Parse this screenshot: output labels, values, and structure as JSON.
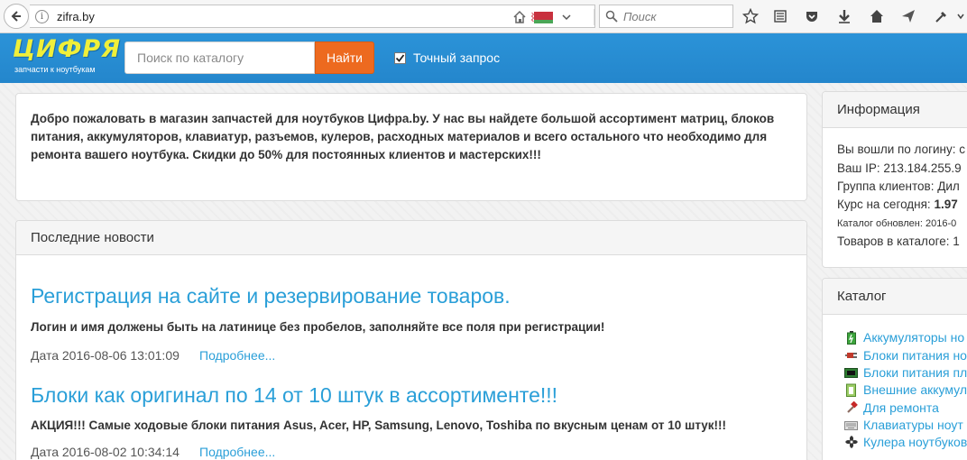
{
  "browser": {
    "url": "zifra.by",
    "search_placeholder": "Поиск"
  },
  "header": {
    "logo_text": "ЦИФРЯ",
    "logo_subtitle": "запчасти к ноутбукам",
    "search_placeholder": "Поиск по каталогу",
    "find_button": "Найти",
    "exact_label": "Точный запрос",
    "exact_checked": true
  },
  "welcome": {
    "text": "Добро пожаловать в магазин запчастей для ноутбуков Цифра.by. У нас вы найдете большой ассортимент матриц, блоков питания, аккумуляторов, клавиатур, разъемов, кулеров, расходных материалов и всего остального что необходимо для ремонта вашего ноутбука. Скидки до 50% для постоянных клиентов и мастерских!!!"
  },
  "news": {
    "heading": "Последние новости",
    "items": [
      {
        "title": "Регистрация на сайте и резервирование товаров.",
        "text": "Логин и имя должены быть на латинице без пробелов, заполняйте все поля при регистрации!",
        "date": "Дата 2016-08-06 13:01:09",
        "more": "Подробнее..."
      },
      {
        "title": "Блоки как оригинал по 14 от 10 штук в ассортименте!!!",
        "text": "АКЦИЯ!!! Самые ходовые блоки питания Asus, Acer, HP, Samsung, Lenovo, Toshiba по вкусным ценам от 10 штук!!!",
        "date": "Дата 2016-08-02 10:34:14",
        "more": "Подробнее..."
      }
    ]
  },
  "info": {
    "heading": "Информация",
    "login_label": "Вы вошли по логину: с",
    "ip_label": "Ваш IP: 213.184.255.9",
    "group_label": "Группа клиентов: Дил",
    "rate_label": "Курс на сегодня: ",
    "rate_value": "1.97",
    "catalog_updated": "Каталог обновлен: 2016-0",
    "goods_count": "Товаров в каталоге: 1"
  },
  "catalog": {
    "heading": "Каталог",
    "items": [
      {
        "label": "Аккумуляторы но",
        "icon": "battery-icon"
      },
      {
        "label": "Блоки питания но",
        "icon": "power-plug-icon"
      },
      {
        "label": "Блоки питания пл",
        "icon": "power-adapter-icon"
      },
      {
        "label": "Внешние аккумул",
        "icon": "external-battery-icon"
      },
      {
        "label": "Для ремонта",
        "icon": "hammer-icon"
      },
      {
        "label": "Клавиатуры ноут",
        "icon": "keyboard-icon"
      },
      {
        "label": "Кулера ноутбуков",
        "icon": "fan-icon"
      }
    ]
  },
  "colors": {
    "header_bg": "#2b93d8",
    "accent_orange": "#ed6a1f",
    "link_blue": "#2a9fd8",
    "logo_yellow": "#f0ef3a"
  }
}
